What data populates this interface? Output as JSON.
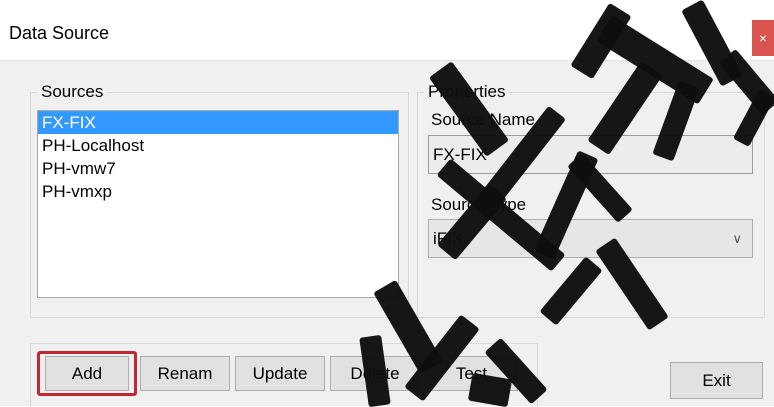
{
  "window": {
    "title": "Data Source",
    "close_label": "×"
  },
  "sources_group": {
    "label": "Sources",
    "items": [
      {
        "label": "FX-FIX",
        "selected": true
      },
      {
        "label": "PH-Localhost",
        "selected": false
      },
      {
        "label": "PH-vmw7",
        "selected": false
      },
      {
        "label": "PH-vmxp",
        "selected": false
      }
    ]
  },
  "properties_group": {
    "label": "Properties",
    "source_name_label": "Source Name",
    "source_name_value": "FX-FIX",
    "source_type_label": "Source Type",
    "source_type_value": "iFIX"
  },
  "buttons": {
    "add": "Add",
    "rename": "Renam",
    "update": "Update",
    "delete": "Delete",
    "test": "Test",
    "exit": "Exit"
  },
  "colors": {
    "selection": "#3399ff",
    "close_button": "#d9534f",
    "highlight_box": "#c0282d"
  }
}
